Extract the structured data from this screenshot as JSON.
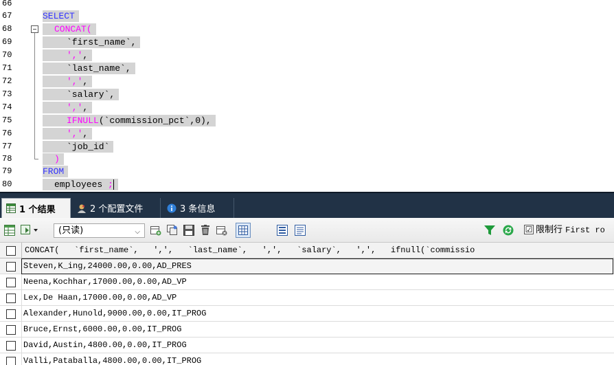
{
  "editor": {
    "line_numbers": [
      "66",
      "67",
      "68",
      "69",
      "70",
      "71",
      "72",
      "73",
      "74",
      "75",
      "76",
      "77",
      "78",
      "79",
      "80"
    ],
    "lines": [
      {
        "parts": []
      },
      {
        "parts": [
          {
            "t": "SELECT",
            "c": "blue"
          }
        ]
      },
      {
        "parts": [
          {
            "t": "CONCAT",
            "c": "pink"
          },
          {
            "t": "(",
            "c": "pink"
          }
        ]
      },
      {
        "parts": [
          {
            "t": "`first_name`,",
            "c": "black"
          }
        ]
      },
      {
        "parts": [
          {
            "t": "','",
            "c": "pink"
          },
          {
            "t": ",",
            "c": "black"
          }
        ]
      },
      {
        "parts": [
          {
            "t": "`last_name`,",
            "c": "black"
          }
        ]
      },
      {
        "parts": [
          {
            "t": "','",
            "c": "pink"
          },
          {
            "t": ",",
            "c": "black"
          }
        ]
      },
      {
        "parts": [
          {
            "t": "`salary`,",
            "c": "black"
          }
        ]
      },
      {
        "parts": [
          {
            "t": "','",
            "c": "pink"
          },
          {
            "t": ",",
            "c": "black"
          }
        ]
      },
      {
        "parts": [
          {
            "t": "IFNULL",
            "c": "pink"
          },
          {
            "t": "(`commission_pct`,0),",
            "c": "black"
          }
        ]
      },
      {
        "parts": [
          {
            "t": "','",
            "c": "pink"
          },
          {
            "t": ",",
            "c": "black"
          }
        ]
      },
      {
        "parts": [
          {
            "t": "`job_id`",
            "c": "black"
          }
        ]
      },
      {
        "parts": [
          {
            "t": ")",
            "c": "pink"
          }
        ]
      },
      {
        "parts": [
          {
            "t": "FROM",
            "c": "blue"
          }
        ]
      },
      {
        "parts": [
          {
            "t": "employees ",
            "c": "black"
          },
          {
            "t": ";",
            "c": "pink"
          }
        ]
      }
    ]
  },
  "tabs": [
    {
      "label": "1 个结果",
      "icon": "table-result-icon",
      "active": true
    },
    {
      "label": "2 个配置文件",
      "icon": "profile-icon",
      "active": false
    },
    {
      "label": "3 条信息",
      "icon": "info-icon",
      "active": false
    }
  ],
  "toolbar": {
    "mode_value": "(只读)",
    "limit_checked": "☑",
    "limit_label": "限制行",
    "limit_rows_label": "First ro"
  },
  "grid": {
    "header": "CONCAT(   `first_name`,   ',',   `last_name`,   ',',   `salary`,   ',',   ifnull(`commissio",
    "rows": [
      "Steven,K_ing,24000.00,0.00,AD_PRES",
      "Neena,Kochhar,17000.00,0.00,AD_VP",
      "Lex,De Haan,17000.00,0.00,AD_VP",
      "Alexander,Hunold,9000.00,0.00,IT_PROG",
      "Bruce,Ernst,6000.00,0.00,IT_PROG",
      "David,Austin,4800.00,0.00,IT_PROG",
      "Valli,Pataballa,4800.00,0.00,IT_PROG"
    ]
  },
  "colors": {
    "keyword_blue": "#3232ff",
    "keyword_pink": "#ff00ff",
    "tabbar_bg": "#213246",
    "selection_bg": "#d4d4d4"
  }
}
